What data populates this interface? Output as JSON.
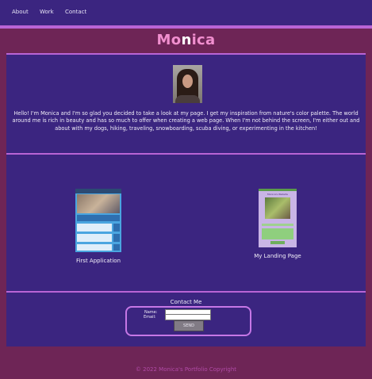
{
  "nav": {
    "about": "About",
    "work": "Work",
    "contact": "Contact"
  },
  "brand": {
    "part1": "Mo",
    "part2": "n",
    "part3": "ica"
  },
  "intro": "Hello! I'm Monica and I'm so glad you decided to take a look at my page. I get my inspiration from nature's color palette. The world around me is rich in beauty and has so much to offer when creating a web page. When I'm not behind the screen, I'm either out and about with my dogs, hiking, traveling, snowboarding, scuba diving, or experimenting in the kitchen!",
  "work": {
    "first_caption": "First Application",
    "landing_caption": "My Landing Page",
    "landing_thumb_title": "Monica's Website"
  },
  "contact": {
    "title": "Contact Me",
    "name_label": "Name:",
    "email_label": "Email:",
    "send_label": "SEND"
  },
  "footer": "© 2022 Monica's Portfolio Copyright"
}
